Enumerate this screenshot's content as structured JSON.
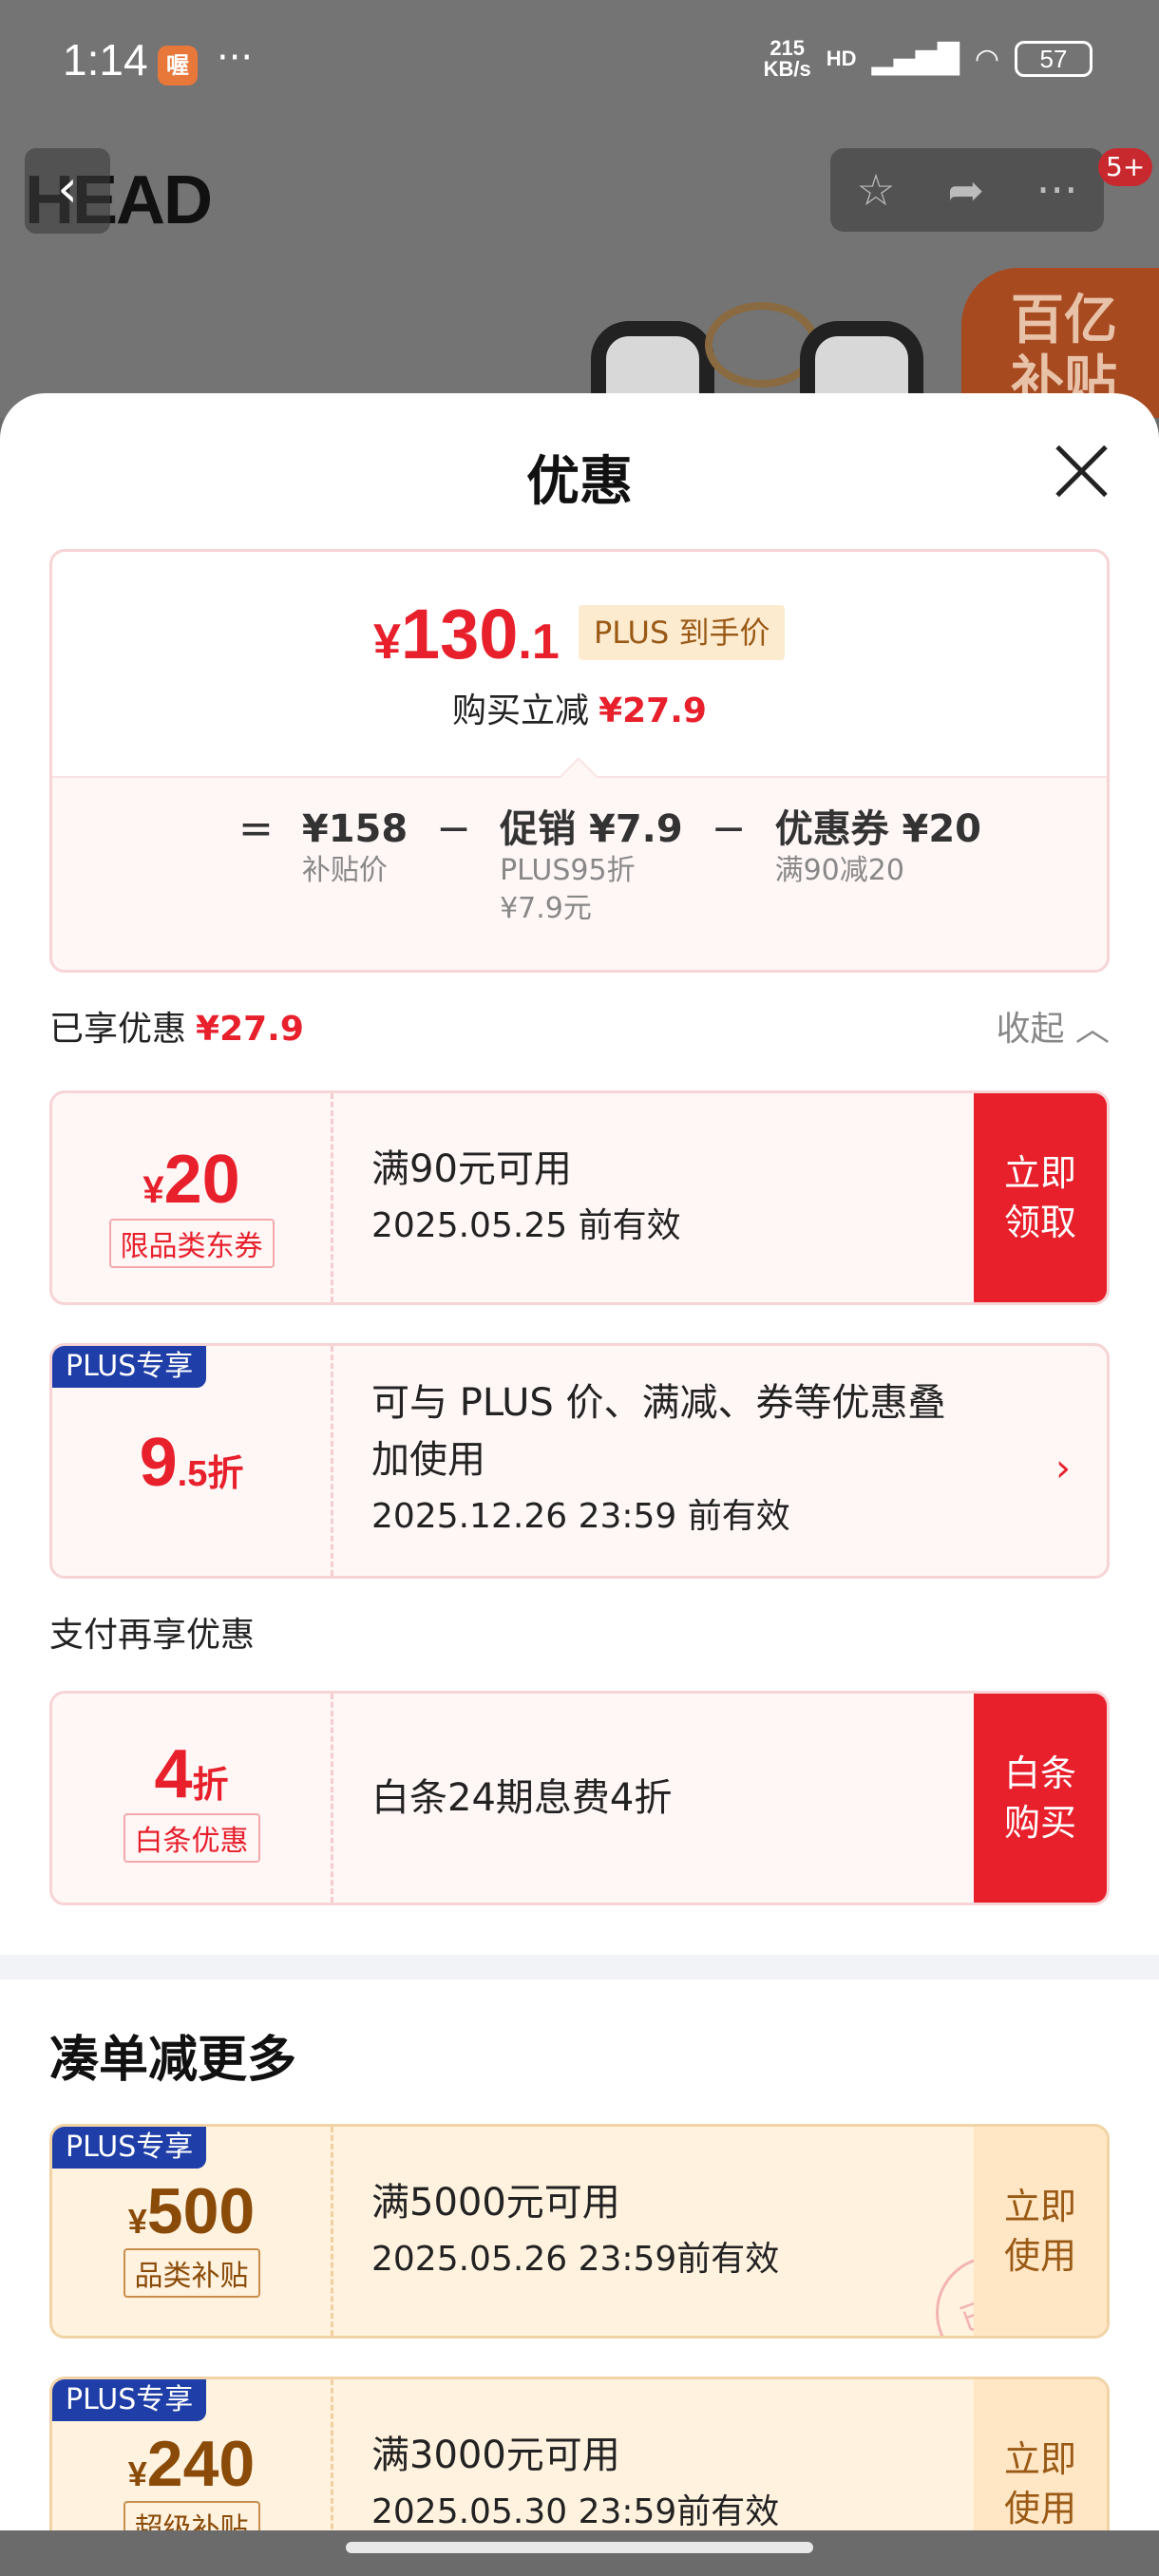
{
  "status_bar": {
    "time": "1:14",
    "app_icon_text": "喔",
    "dots": "···",
    "net_speed_value": "215",
    "net_speed_unit": "KB/s",
    "hd": "HD",
    "battery": "57"
  },
  "background": {
    "brand": "HEAD",
    "cart_badge": "5+",
    "subsidy_text_1": "百亿",
    "subsidy_text_2": "补贴"
  },
  "sheet": {
    "title": "优惠",
    "price_summary": {
      "currency": "¥",
      "price_int": "130",
      "price_dec": ".1",
      "plus_tag": "PLUS 到手价",
      "buy_reduce_label": "购买立减",
      "buy_reduce_amount": "¥27.9",
      "formula": {
        "eq": "=",
        "subsidy_price": "¥158",
        "subsidy_label": "补贴价",
        "minus1": "−",
        "promo": "促销 ¥7.9",
        "promo_sub1": "PLUS95折",
        "promo_sub2": "¥7.9元",
        "minus2": "−",
        "coupon": "优惠券 ¥20",
        "coupon_sub": "满90减20"
      }
    },
    "enjoyed": {
      "label": "已享优惠",
      "amount": "¥27.9",
      "collapse_label": "收起"
    },
    "coupons": [
      {
        "currency": "¥",
        "value": "20",
        "tag": "限品类东券",
        "condition": "满90元可用",
        "validity": "2025.05.25 前有效",
        "action": "立即领取"
      },
      {
        "plus_label": "PLUS专享",
        "value_int": "9",
        "value_dec": ".5折",
        "line1": "可与 PLUS 价、满减、券等优惠叠",
        "line2": "加使用",
        "validity": "2025.12.26 23:59 前有效",
        "chevron": "›"
      }
    ],
    "payment_section_label": "支付再享优惠",
    "payment_coupon": {
      "value": "4",
      "unit": "折",
      "tag": "白条优惠",
      "text": "白条24期息费4折",
      "action": "白条购买"
    },
    "more_title": "凑单减更多",
    "more_coupons": [
      {
        "plus_label": "PLUS专享",
        "currency": "¥",
        "value": "500",
        "tag": "品类补贴",
        "condition": "满5000元可用",
        "validity": "2025.05.26 23:59前有效",
        "action": "立即使用",
        "stamp": "已领"
      },
      {
        "plus_label": "PLUS专享",
        "currency": "¥",
        "value": "240",
        "tag": "超级补贴",
        "condition": "满3000元可用",
        "validity": "2025.05.30 23:59前有效",
        "action": "立即使用"
      }
    ]
  }
}
